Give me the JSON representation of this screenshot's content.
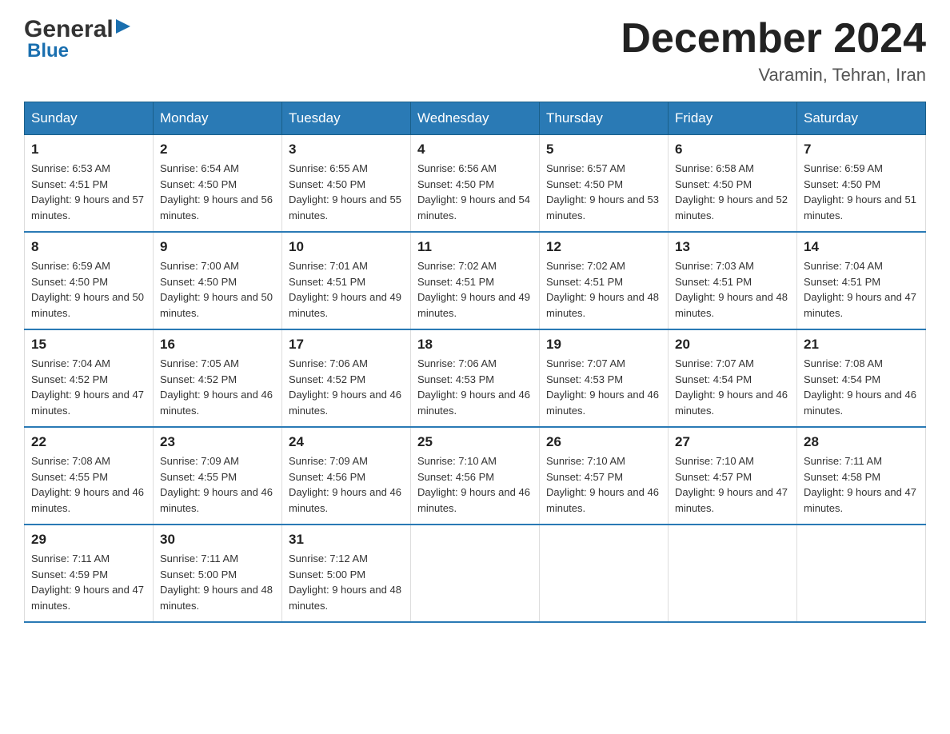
{
  "header": {
    "logo_general": "General",
    "logo_blue": "Blue",
    "month_title": "December 2024",
    "location": "Varamin, Tehran, Iran"
  },
  "days_of_week": [
    "Sunday",
    "Monday",
    "Tuesday",
    "Wednesday",
    "Thursday",
    "Friday",
    "Saturday"
  ],
  "weeks": [
    [
      {
        "day": "1",
        "sunrise": "6:53 AM",
        "sunset": "4:51 PM",
        "daylight": "9 hours and 57 minutes."
      },
      {
        "day": "2",
        "sunrise": "6:54 AM",
        "sunset": "4:50 PM",
        "daylight": "9 hours and 56 minutes."
      },
      {
        "day": "3",
        "sunrise": "6:55 AM",
        "sunset": "4:50 PM",
        "daylight": "9 hours and 55 minutes."
      },
      {
        "day": "4",
        "sunrise": "6:56 AM",
        "sunset": "4:50 PM",
        "daylight": "9 hours and 54 minutes."
      },
      {
        "day": "5",
        "sunrise": "6:57 AM",
        "sunset": "4:50 PM",
        "daylight": "9 hours and 53 minutes."
      },
      {
        "day": "6",
        "sunrise": "6:58 AM",
        "sunset": "4:50 PM",
        "daylight": "9 hours and 52 minutes."
      },
      {
        "day": "7",
        "sunrise": "6:59 AM",
        "sunset": "4:50 PM",
        "daylight": "9 hours and 51 minutes."
      }
    ],
    [
      {
        "day": "8",
        "sunrise": "6:59 AM",
        "sunset": "4:50 PM",
        "daylight": "9 hours and 50 minutes."
      },
      {
        "day": "9",
        "sunrise": "7:00 AM",
        "sunset": "4:50 PM",
        "daylight": "9 hours and 50 minutes."
      },
      {
        "day": "10",
        "sunrise": "7:01 AM",
        "sunset": "4:51 PM",
        "daylight": "9 hours and 49 minutes."
      },
      {
        "day": "11",
        "sunrise": "7:02 AM",
        "sunset": "4:51 PM",
        "daylight": "9 hours and 49 minutes."
      },
      {
        "day": "12",
        "sunrise": "7:02 AM",
        "sunset": "4:51 PM",
        "daylight": "9 hours and 48 minutes."
      },
      {
        "day": "13",
        "sunrise": "7:03 AM",
        "sunset": "4:51 PM",
        "daylight": "9 hours and 48 minutes."
      },
      {
        "day": "14",
        "sunrise": "7:04 AM",
        "sunset": "4:51 PM",
        "daylight": "9 hours and 47 minutes."
      }
    ],
    [
      {
        "day": "15",
        "sunrise": "7:04 AM",
        "sunset": "4:52 PM",
        "daylight": "9 hours and 47 minutes."
      },
      {
        "day": "16",
        "sunrise": "7:05 AM",
        "sunset": "4:52 PM",
        "daylight": "9 hours and 46 minutes."
      },
      {
        "day": "17",
        "sunrise": "7:06 AM",
        "sunset": "4:52 PM",
        "daylight": "9 hours and 46 minutes."
      },
      {
        "day": "18",
        "sunrise": "7:06 AM",
        "sunset": "4:53 PM",
        "daylight": "9 hours and 46 minutes."
      },
      {
        "day": "19",
        "sunrise": "7:07 AM",
        "sunset": "4:53 PM",
        "daylight": "9 hours and 46 minutes."
      },
      {
        "day": "20",
        "sunrise": "7:07 AM",
        "sunset": "4:54 PM",
        "daylight": "9 hours and 46 minutes."
      },
      {
        "day": "21",
        "sunrise": "7:08 AM",
        "sunset": "4:54 PM",
        "daylight": "9 hours and 46 minutes."
      }
    ],
    [
      {
        "day": "22",
        "sunrise": "7:08 AM",
        "sunset": "4:55 PM",
        "daylight": "9 hours and 46 minutes."
      },
      {
        "day": "23",
        "sunrise": "7:09 AM",
        "sunset": "4:55 PM",
        "daylight": "9 hours and 46 minutes."
      },
      {
        "day": "24",
        "sunrise": "7:09 AM",
        "sunset": "4:56 PM",
        "daylight": "9 hours and 46 minutes."
      },
      {
        "day": "25",
        "sunrise": "7:10 AM",
        "sunset": "4:56 PM",
        "daylight": "9 hours and 46 minutes."
      },
      {
        "day": "26",
        "sunrise": "7:10 AM",
        "sunset": "4:57 PM",
        "daylight": "9 hours and 46 minutes."
      },
      {
        "day": "27",
        "sunrise": "7:10 AM",
        "sunset": "4:57 PM",
        "daylight": "9 hours and 47 minutes."
      },
      {
        "day": "28",
        "sunrise": "7:11 AM",
        "sunset": "4:58 PM",
        "daylight": "9 hours and 47 minutes."
      }
    ],
    [
      {
        "day": "29",
        "sunrise": "7:11 AM",
        "sunset": "4:59 PM",
        "daylight": "9 hours and 47 minutes."
      },
      {
        "day": "30",
        "sunrise": "7:11 AM",
        "sunset": "5:00 PM",
        "daylight": "9 hours and 48 minutes."
      },
      {
        "day": "31",
        "sunrise": "7:12 AM",
        "sunset": "5:00 PM",
        "daylight": "9 hours and 48 minutes."
      },
      {
        "day": "",
        "sunrise": "",
        "sunset": "",
        "daylight": ""
      },
      {
        "day": "",
        "sunrise": "",
        "sunset": "",
        "daylight": ""
      },
      {
        "day": "",
        "sunrise": "",
        "sunset": "",
        "daylight": ""
      },
      {
        "day": "",
        "sunrise": "",
        "sunset": "",
        "daylight": ""
      }
    ]
  ]
}
